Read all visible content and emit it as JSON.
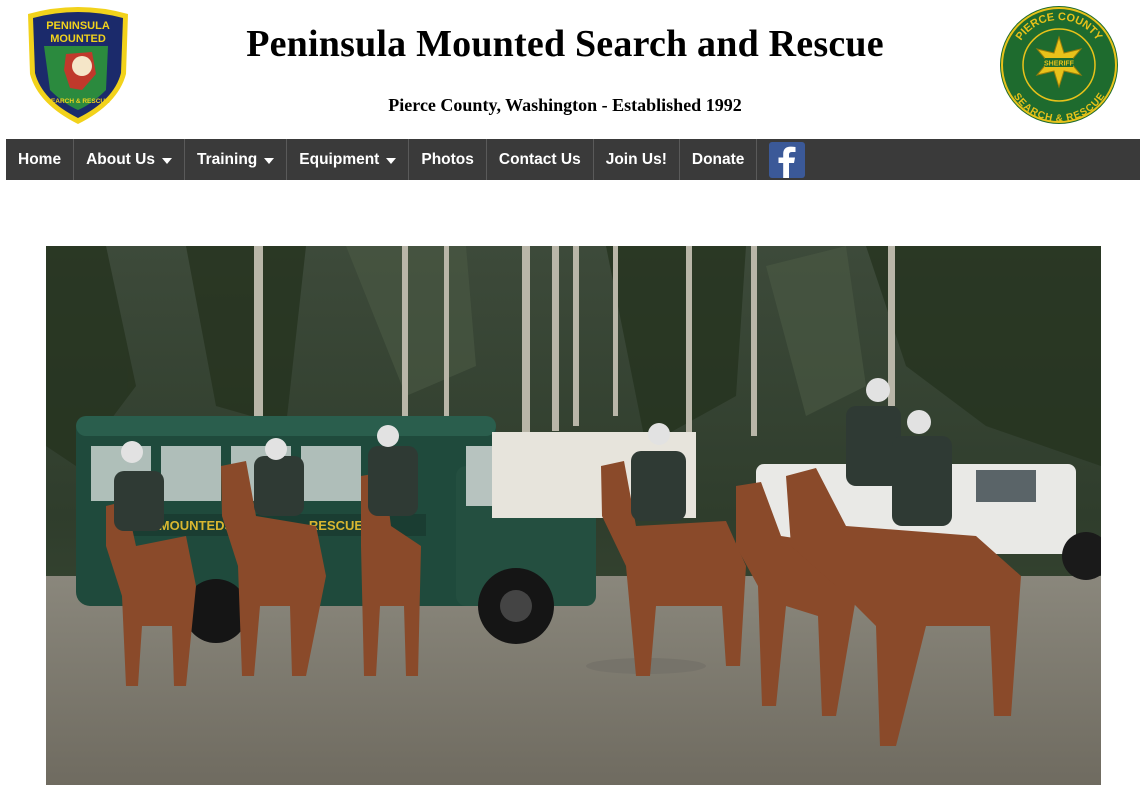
{
  "header": {
    "title": "Peninsula Mounted Search and Rescue",
    "subtitle": "Pierce County, Washington - Established 1992",
    "left_logo": {
      "icon": "peninsula-mounted-badge",
      "text_top": "PENINSULA",
      "text_mid": "MOUNTED",
      "text_bottom": "SEARCH & RESCUE"
    },
    "right_logo": {
      "icon": "pierce-county-sheriff-seal",
      "text_top": "PIERCE COUNTY",
      "text_bottom": "SEARCH & RESCUE",
      "star_text": "SHERIFF"
    }
  },
  "nav": {
    "items": [
      {
        "label": "Home",
        "dropdown": false
      },
      {
        "label": "About Us",
        "dropdown": true
      },
      {
        "label": "Training",
        "dropdown": true
      },
      {
        "label": "Equipment",
        "dropdown": true
      },
      {
        "label": "Photos",
        "dropdown": false
      },
      {
        "label": "Contact Us",
        "dropdown": false
      },
      {
        "label": "Join Us!",
        "dropdown": false
      },
      {
        "label": "Donate",
        "dropdown": false
      }
    ],
    "facebook_icon": "facebook-icon",
    "background": "#3a3a3a"
  },
  "hero": {
    "bus_text_left": "MOUNTEDS",
    "bus_text_right": "RESCUE"
  },
  "colors": {
    "badge_navy": "#1b2a6b",
    "badge_gold": "#f2d21b",
    "seal_green": "#1e6b2e",
    "facebook": "#3b5998"
  }
}
